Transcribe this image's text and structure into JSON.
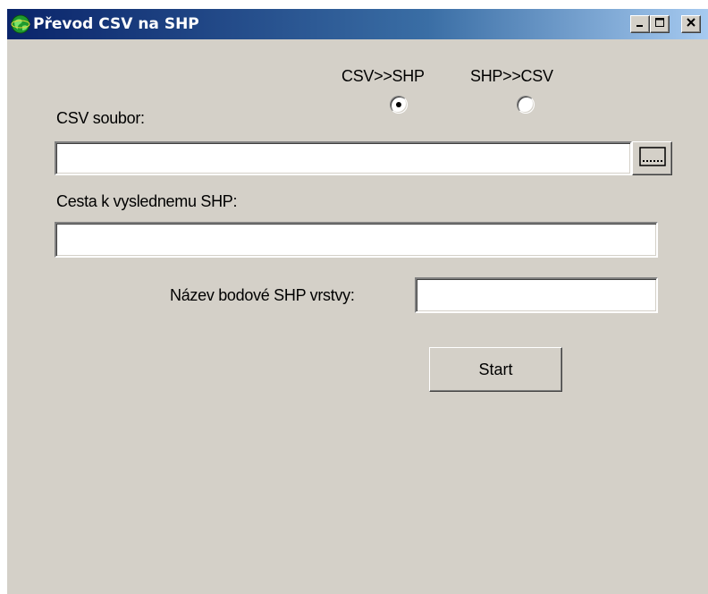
{
  "window": {
    "title": "Převod CSV na SHP"
  },
  "mode": {
    "options": [
      {
        "label": "CSV>>SHP",
        "selected": true
      },
      {
        "label": "SHP>>CSV",
        "selected": false
      }
    ]
  },
  "csv_file": {
    "label": "CSV soubor:",
    "value": "",
    "browse_icon": "ellipsis-icon"
  },
  "output_path": {
    "label": "Cesta k vyslednemu SHP:",
    "value": ""
  },
  "layer_name": {
    "label": "Název bodové SHP vrstvy:",
    "value": ""
  },
  "start_button": {
    "label": "Start"
  },
  "colors": {
    "face": "#d4d0c8",
    "title_start": "#0a246a",
    "title_end": "#a6caf0"
  }
}
